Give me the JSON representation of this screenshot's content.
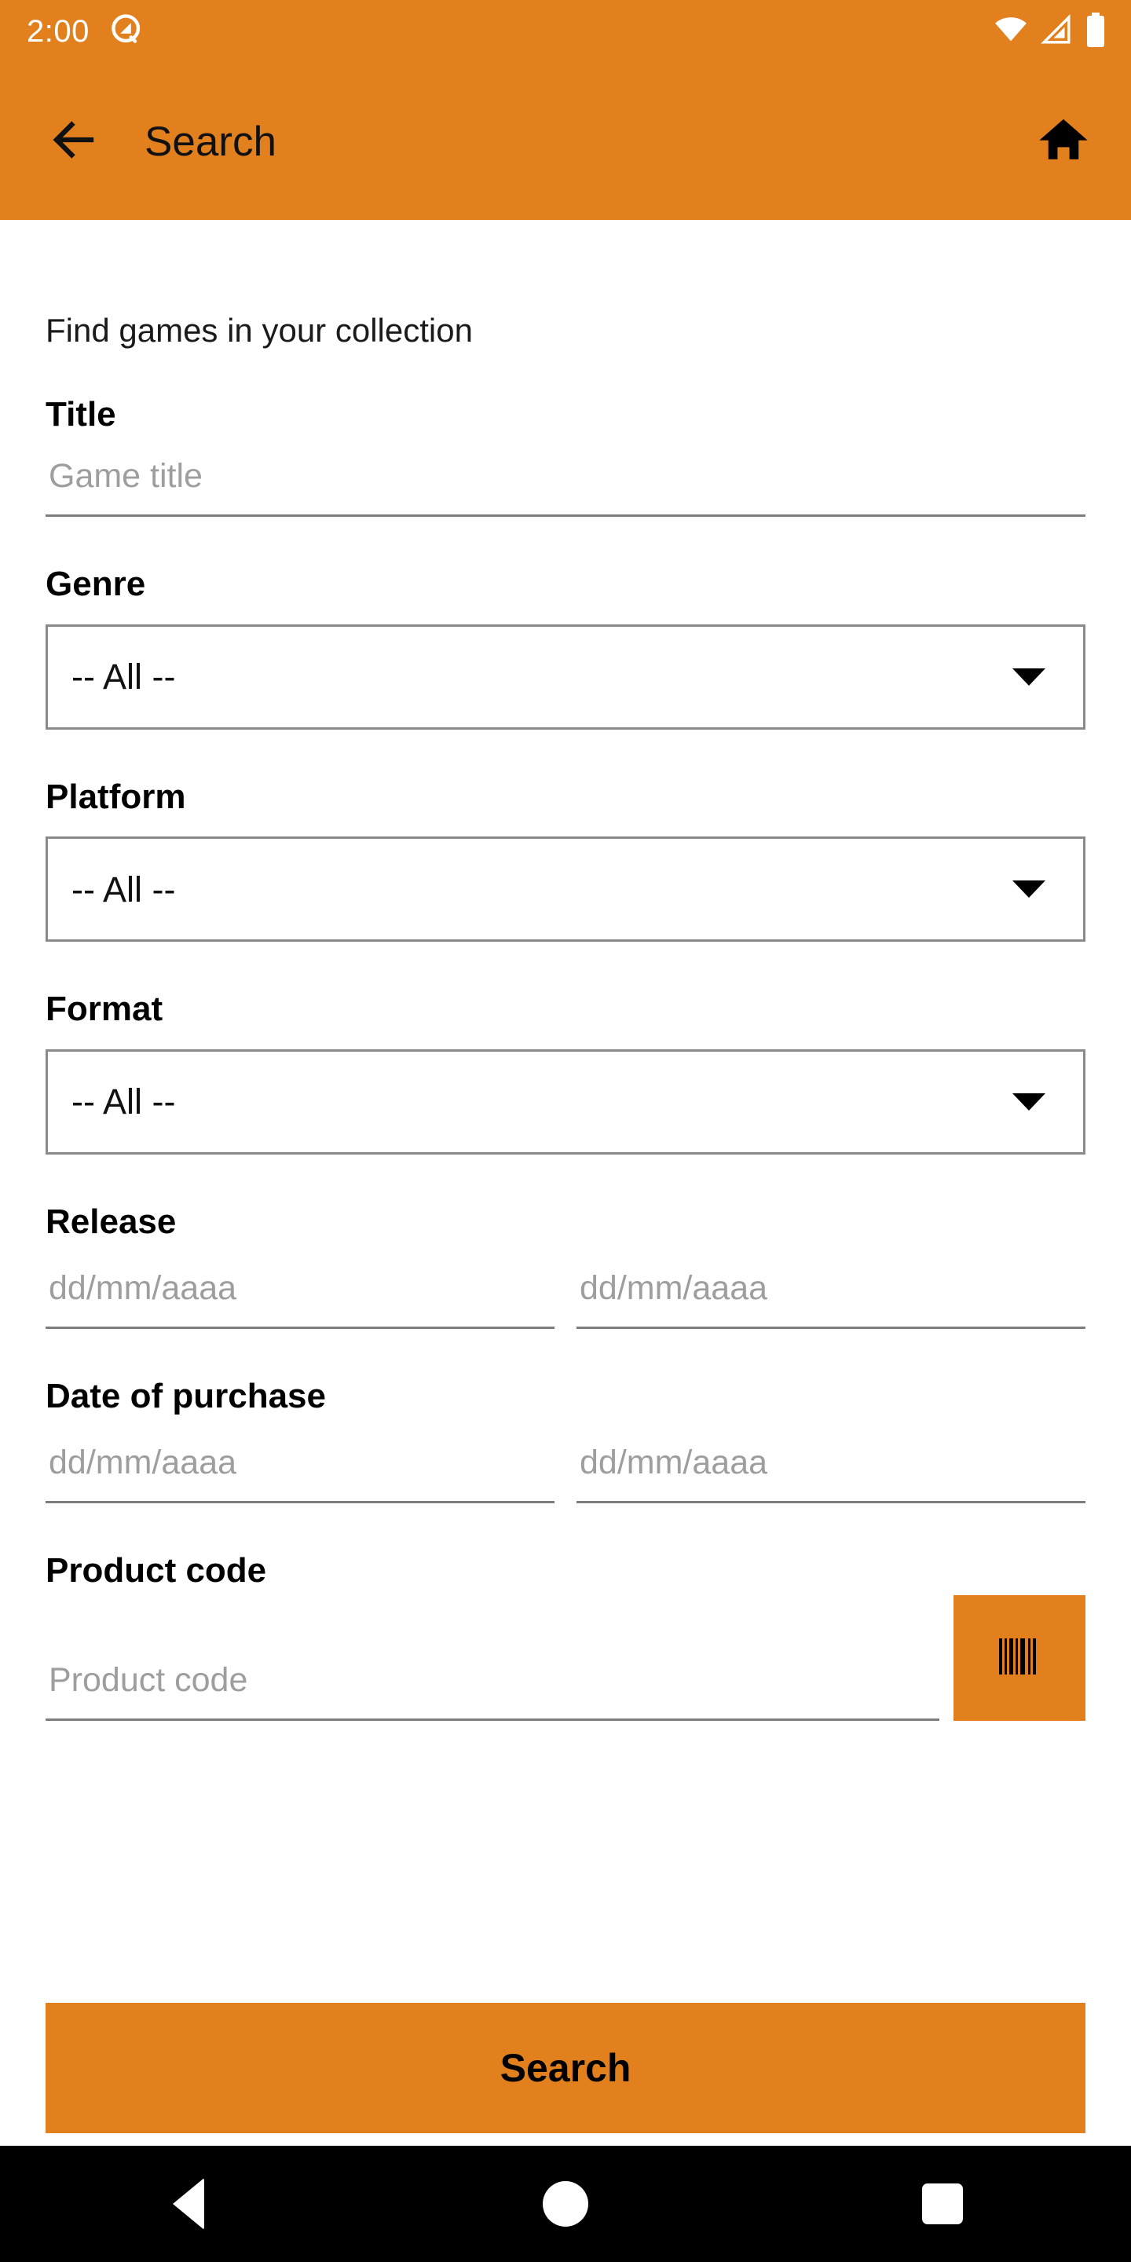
{
  "status_bar": {
    "time": "2:00",
    "icons": [
      "android-q-icon",
      "wifi-icon",
      "cellular-signal-icon",
      "battery-icon"
    ]
  },
  "app_bar": {
    "back_icon": "arrow-left-icon",
    "title": "Search",
    "home_icon": "home-icon"
  },
  "colors": {
    "accent": "#E2801E",
    "text": "#111111",
    "placeholder": "#9E9E9E",
    "line": "#7D7D7D",
    "box_border": "#8A8A8A",
    "nav_bar": "#000000"
  },
  "form": {
    "intro": "Find games in your collection",
    "title": {
      "label": "Title",
      "placeholder": "Game title",
      "value": ""
    },
    "genre": {
      "label": "Genre",
      "selected": "-- All --",
      "caret_icon": "chevron-down-icon"
    },
    "platform": {
      "label": "Platform",
      "selected": "-- All --",
      "caret_icon": "chevron-down-icon"
    },
    "format": {
      "label": "Format",
      "selected": "-- All --",
      "caret_icon": "chevron-down-icon"
    },
    "release": {
      "label": "Release",
      "from_placeholder": "dd/mm/aaaa",
      "to_placeholder": "dd/mm/aaaa",
      "from_value": "",
      "to_value": ""
    },
    "purchase": {
      "label": "Date of purchase",
      "from_placeholder": "dd/mm/aaaa",
      "to_placeholder": "dd/mm/aaaa",
      "from_value": "",
      "to_value": ""
    },
    "product_code": {
      "label": "Product code",
      "placeholder": "Product code",
      "value": "",
      "scan_icon": "barcode-icon"
    },
    "submit_label": "Search"
  },
  "nav_bar": {
    "back": "back-triangle-icon",
    "home": "home-circle-icon",
    "recents": "recents-square-icon"
  }
}
